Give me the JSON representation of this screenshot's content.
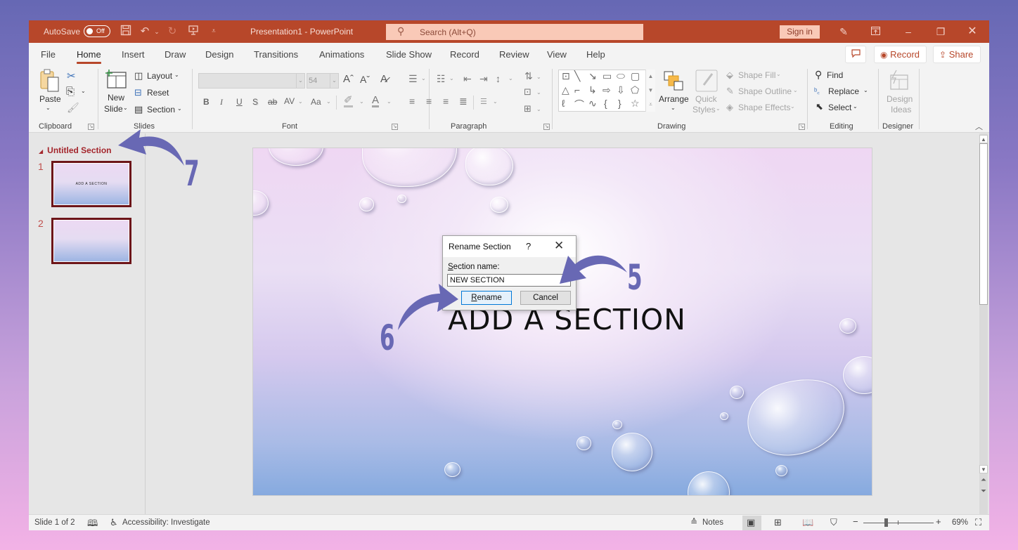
{
  "app": {
    "autosave_label": "AutoSave",
    "autosave_state": "Off",
    "doc_title": "Presentation1  -  PowerPoint",
    "search_placeholder": "Search (Alt+Q)",
    "sign_in": "Sign in",
    "qat_icons": [
      "save-icon",
      "undo-icon",
      "redo-icon",
      "present-from-start-icon",
      "customize-qat-icon"
    ],
    "window_controls": [
      "coauthor-icon",
      "ribbon-display-options-icon",
      "minimize-icon",
      "restore-icon",
      "close-icon"
    ]
  },
  "tabs": [
    {
      "label": "File"
    },
    {
      "label": "Home",
      "active": true
    },
    {
      "label": "Insert"
    },
    {
      "label": "Draw"
    },
    {
      "label": "Design"
    },
    {
      "label": "Transitions"
    },
    {
      "label": "Animations"
    },
    {
      "label": "Slide Show"
    },
    {
      "label": "Record"
    },
    {
      "label": "Review"
    },
    {
      "label": "View"
    },
    {
      "label": "Help"
    }
  ],
  "tab_actions": {
    "comments_icon": "comment-icon",
    "record": "Record",
    "share": "Share"
  },
  "ribbon": {
    "clipboard": {
      "label": "Clipboard",
      "paste": "Paste",
      "icons": [
        "cut-icon",
        "copy-icon",
        "format-painter-icon"
      ]
    },
    "slides": {
      "label": "Slides",
      "new_slide_line1": "New",
      "new_slide_line2": "Slide",
      "layout": "Layout",
      "reset": "Reset",
      "section": "Section"
    },
    "font": {
      "label": "Font",
      "font_name": "",
      "font_size": "54",
      "buttons": [
        "B",
        "I",
        "U",
        "S",
        "ab",
        "AV",
        "Aa"
      ]
    },
    "paragraph": {
      "label": "Paragraph"
    },
    "drawing": {
      "label": "Drawing",
      "arrange": "Arrange",
      "quick_styles_line1": "Quick",
      "quick_styles_line2": "Styles",
      "shape_fill": "Shape Fill",
      "shape_outline": "Shape Outline",
      "shape_effects": "Shape Effects"
    },
    "editing": {
      "label": "Editing",
      "find": "Find",
      "replace": "Replace",
      "select": "Select"
    },
    "designer": {
      "label": "Designer",
      "design_ideas_line1": "Design",
      "design_ideas_line2": "Ideas"
    }
  },
  "thumbnails": {
    "section_name": "Untitled Section",
    "slides": [
      {
        "number": "1",
        "title": "ADD A SECTION"
      },
      {
        "number": "2",
        "title": ""
      }
    ]
  },
  "slide": {
    "title": "ADD A SECTION"
  },
  "dialog": {
    "title": "Rename Section",
    "help": "?",
    "label_prefix": "S",
    "label_rest": "ection name:",
    "input_value": "NEW SECTION",
    "rename_prefix": "R",
    "rename_rest": "ename",
    "cancel": "Cancel"
  },
  "statusbar": {
    "slide_info": "Slide 1 of 2",
    "accessibility": "Accessibility: Investigate",
    "notes": "Notes",
    "zoom_level": "69%",
    "zoom_percent": 69
  },
  "annotations": [
    "5",
    "6",
    "7"
  ],
  "colors": {
    "accent": "#b7472a",
    "section_header": "#a4262c",
    "annotation": "#6868b4",
    "dialog_primary_border": "#0078d7"
  }
}
